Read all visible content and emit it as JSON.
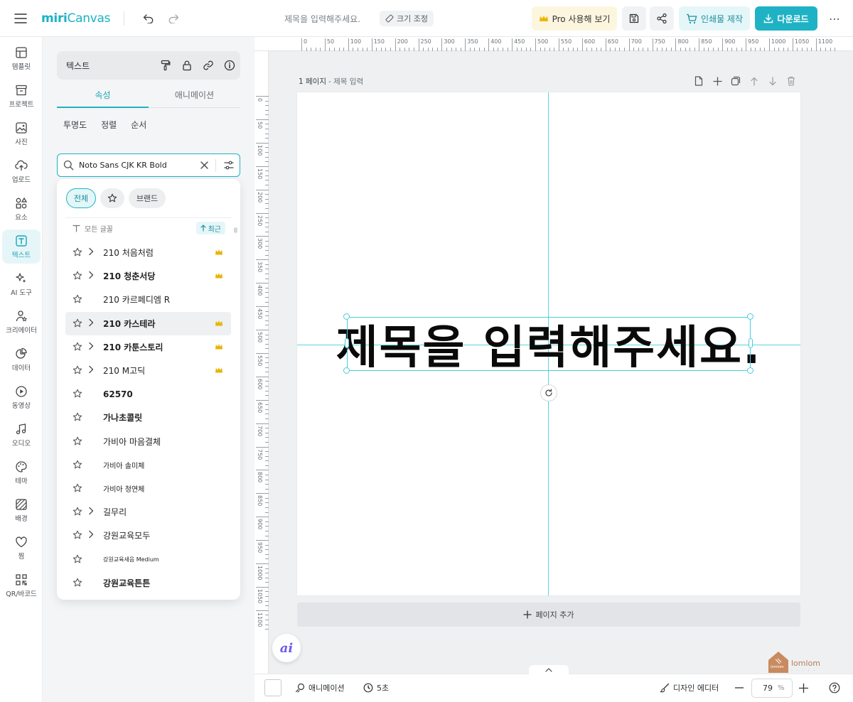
{
  "app": {
    "logo_part1": "miri",
    "logo_part2": "Canvas",
    "doc_title": "제목을 입력해주세요.",
    "resize_label": "크기 조정",
    "pro_label": "Pro 사용해 보기",
    "print_label": "인쇄물 제작",
    "download_label": "다운로드",
    "more_label": "⋯"
  },
  "nav": {
    "items": [
      {
        "label": "템플릿",
        "icon": "template-icon"
      },
      {
        "label": "프로젝트",
        "icon": "project-icon"
      },
      {
        "label": "사진",
        "icon": "photo-icon"
      },
      {
        "label": "업로드",
        "icon": "upload-icon"
      },
      {
        "label": "요소",
        "icon": "elements-icon"
      },
      {
        "label": "텍스트",
        "icon": "text-icon"
      },
      {
        "label": "AI 도구",
        "icon": "ai-tools-icon"
      },
      {
        "label": "크리에이터",
        "icon": "creator-icon"
      },
      {
        "label": "데이터",
        "icon": "data-icon"
      },
      {
        "label": "동영상",
        "icon": "video-icon"
      },
      {
        "label": "오디오",
        "icon": "audio-icon"
      },
      {
        "label": "테마",
        "icon": "theme-icon"
      },
      {
        "label": "배경",
        "icon": "background-icon"
      },
      {
        "label": "찜",
        "icon": "heart-icon"
      },
      {
        "label": "QR/바코드",
        "icon": "qr-icon"
      }
    ],
    "active": "텍스트"
  },
  "panel": {
    "header_title": "텍스트",
    "tabs": [
      "속성",
      "애니메이션"
    ],
    "subtabs": [
      "투명도",
      "정렬",
      "순서"
    ],
    "search_value": "Noto Sans CJK KR Bold",
    "chips": [
      "전체",
      "브랜드"
    ],
    "all_fonts_label": "모든 글꼴",
    "recent_label": "최근",
    "fonts": [
      {
        "name": "210 처음처럼",
        "expandable": true,
        "premium": true
      },
      {
        "name": "210 청춘서당",
        "expandable": true,
        "premium": true
      },
      {
        "name": "210 카르페디엠 R",
        "expandable": false,
        "premium": false
      },
      {
        "name": "210 카스테라",
        "expandable": true,
        "premium": true,
        "hover": true
      },
      {
        "name": "210 카툰스토리",
        "expandable": true,
        "premium": true
      },
      {
        "name": "210 M고딕",
        "expandable": true,
        "premium": true
      },
      {
        "name": "62570",
        "expandable": false,
        "premium": false
      },
      {
        "name": "가나초콜릿",
        "expandable": false,
        "premium": false
      },
      {
        "name": "가비아 마음결체",
        "expandable": false,
        "premium": false
      },
      {
        "name": "가비아 솔미체",
        "expandable": false,
        "premium": false
      },
      {
        "name": "가비아 청연체",
        "expandable": false,
        "premium": false
      },
      {
        "name": "길무리",
        "expandable": true,
        "premium": false
      },
      {
        "name": "강원교육모두",
        "expandable": true,
        "premium": false
      },
      {
        "name": "강원교육새음 Medium",
        "expandable": false,
        "premium": false
      },
      {
        "name": "강원교육튼튼",
        "expandable": false,
        "premium": false
      }
    ]
  },
  "canvas": {
    "page_number": "1 페이지",
    "page_name": "- 제목 입력",
    "title_text": "제목을 입력해주세요.",
    "add_page_label": "페이지 추가",
    "ruler_h": [
      "0",
      "50",
      "100",
      "150",
      "200",
      "250",
      "300",
      "350",
      "400",
      "450",
      "500",
      "550",
      "600",
      "650",
      "700",
      "750",
      "800",
      "850",
      "900",
      "950",
      "1000",
      "1050",
      "1100"
    ],
    "ruler_v": [
      "0",
      "50",
      "100",
      "150",
      "200",
      "250",
      "300",
      "350",
      "400",
      "450",
      "500",
      "550",
      "600",
      "650",
      "700",
      "750",
      "800",
      "850",
      "900",
      "950",
      "1000",
      "1050",
      "1100"
    ],
    "ai_label": "ai",
    "brand_name": "lomlom",
    "brand_tag": "lomlom",
    "brand_dots": "·····"
  },
  "bottom": {
    "animation_label": "애니메이션",
    "duration_label": "5초",
    "design_editor_label": "디자인 에디터",
    "zoom_value": "79",
    "zoom_unit": "%"
  },
  "colors": {
    "accent": "#1fb2c4",
    "guide": "#5ad5e3",
    "crown": "#e8b400"
  }
}
